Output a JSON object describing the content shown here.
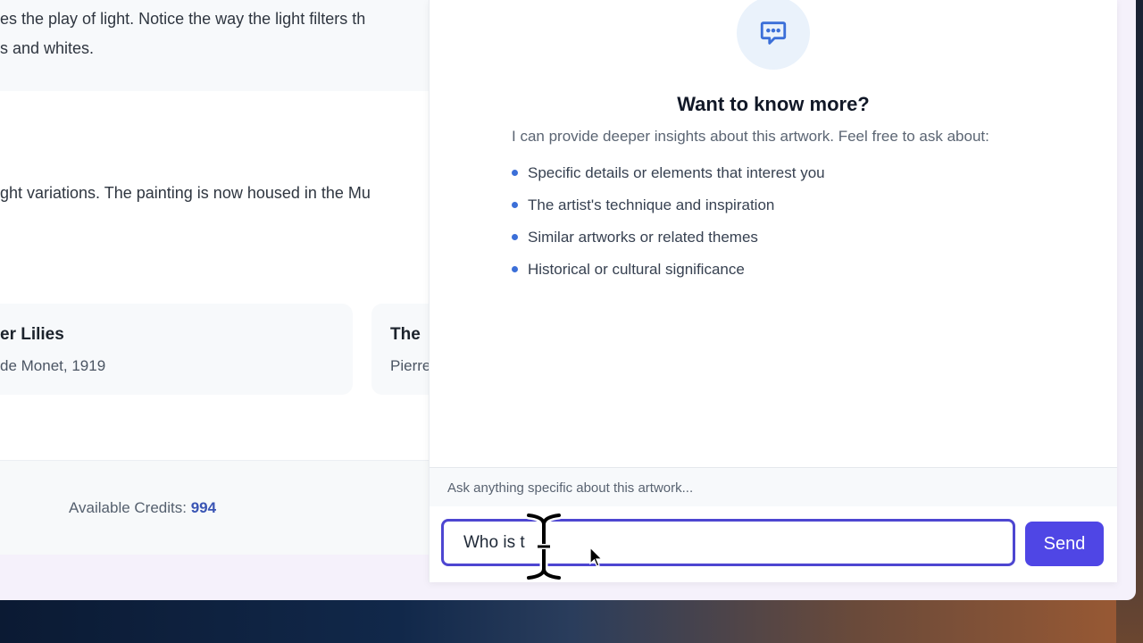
{
  "article": {
    "line1": "es the play of light. Notice the way the light filters th",
    "line2": "s and whites.",
    "line3": "ght variations. The painting is now housed in the Mu"
  },
  "related": [
    {
      "title": "er Lilies",
      "subtitle": "de Monet, 1919"
    },
    {
      "title": "The",
      "subtitle": "Pierre"
    }
  ],
  "footer": {
    "credits_label": "Available Credits:",
    "credits_value": "994"
  },
  "chat": {
    "heading": "Want to know more?",
    "intro": "I can provide deeper insights about this artwork. Feel free to ask about:",
    "topics": [
      "Specific details or elements that interest you",
      "The artist's technique and inspiration",
      "Similar artworks or related themes",
      "Historical or cultural significance"
    ],
    "hint": "Ask anything specific about this artwork...",
    "input_value": "Who is t",
    "send_label": "Send",
    "accent_color": "#4f46e5",
    "icon": "chat-bubble-icon"
  }
}
